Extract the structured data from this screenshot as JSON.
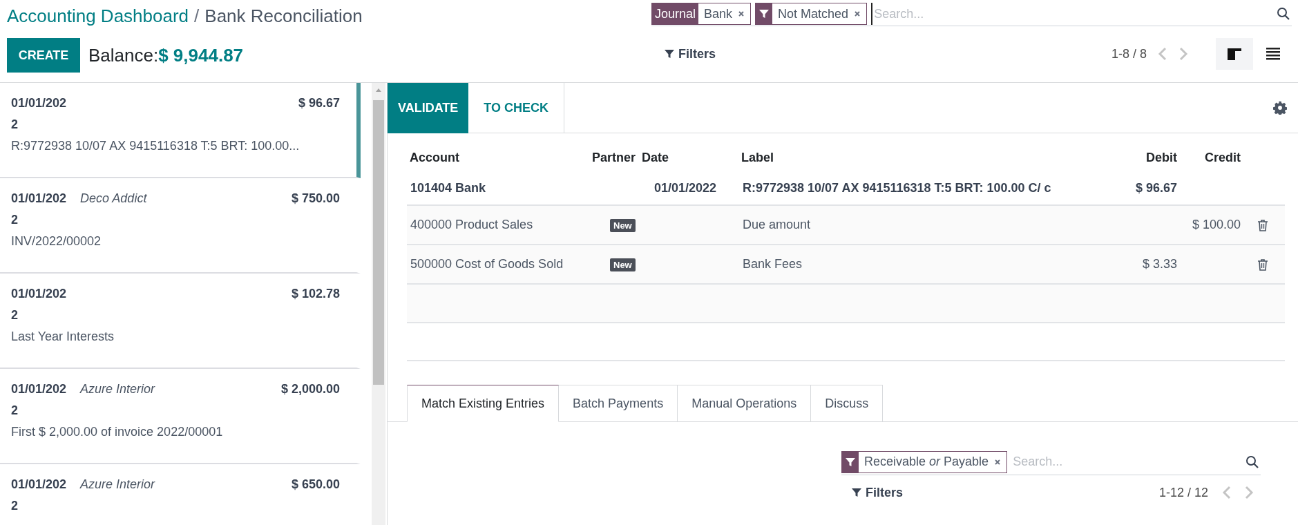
{
  "breadcrumb": [
    {
      "label": "Accounting Dashboard",
      "kind": "link"
    },
    {
      "label": "Bank Reconciliation",
      "kind": "current"
    }
  ],
  "breadcrumb_separator": "/",
  "create_button": "CREATE",
  "balance": {
    "label": "Balance:",
    "value": "$ 9,944.87"
  },
  "search": {
    "facets": [
      {
        "kind": "field",
        "field": "Journal",
        "value": "Bank"
      },
      {
        "kind": "filter",
        "value": "Not Matched"
      }
    ],
    "placeholder": "Search..."
  },
  "filters_button": "Filters",
  "pager": "1-8 / 8",
  "views": [
    {
      "kind": "kanban",
      "selected": true
    },
    {
      "kind": "list",
      "selected": false
    }
  ],
  "statements": [
    {
      "date": "01/01/2022",
      "amount": "$ 96.67",
      "description": "R:9772938 10/07 AX 9415116318 T:5 BRT: 100.00...",
      "selected": true
    },
    {
      "date": "01/01/2022",
      "partner": "Deco Addict",
      "amount": "$ 750.00",
      "description": "INV/2022/00002",
      "selected": false
    },
    {
      "date": "01/01/2022",
      "amount": "$ 102.78",
      "description": "Last Year Interests",
      "selected": false
    },
    {
      "date": "01/01/2022",
      "partner": "Azure Interior",
      "amount": "$ 2,000.00",
      "description": "First $ 2,000.00 of invoice 2022/00001",
      "selected": false
    },
    {
      "date": "01/01/2022",
      "partner": "Azure Interior",
      "amount": "$ 650.00",
      "selected": false
    }
  ],
  "actions": [
    {
      "label": "VALIDATE",
      "kind": "primary"
    },
    {
      "label": "TO CHECK",
      "kind": "secondary"
    }
  ],
  "lines": {
    "columns": [
      "Account",
      "Partner",
      "Date",
      "Label",
      "Debit",
      "Credit"
    ],
    "rows": [
      {
        "kind": "statement",
        "account": "101404 Bank",
        "date": "01/01/2022",
        "label": "R:9772938 10/07 AX 9415116318 T:5 BRT: 100.00 C/ c",
        "debit": "$ 96.67"
      },
      {
        "kind": "line",
        "account": "400000 Product Sales",
        "badge": "New",
        "label": "Due amount",
        "credit": "$ 100.00"
      },
      {
        "kind": "line",
        "account": "500000 Cost of Goods Sold",
        "badge": "New",
        "label": "Bank Fees",
        "debit": "$ 3.33"
      }
    ]
  },
  "tabs": [
    {
      "label": "Match Existing Entries",
      "selected": true
    },
    {
      "label": "Batch Payments",
      "selected": false
    },
    {
      "label": "Manual Operations",
      "selected": false
    },
    {
      "label": "Discuss",
      "selected": false
    }
  ],
  "match_search": {
    "facets": [
      {
        "kind": "filter",
        "value": "Receivable *or* Payable"
      }
    ],
    "placeholder": "Search..."
  },
  "match_filters_button": "Filters",
  "match_pager": "1-12 / 12"
}
